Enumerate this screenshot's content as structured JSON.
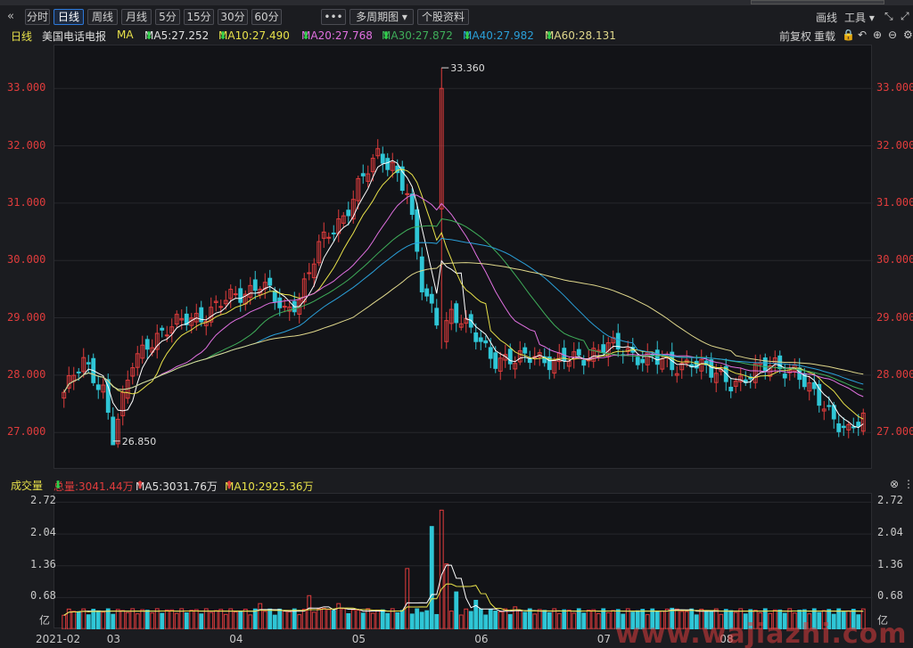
{
  "toolbar": {
    "collapse_icon": "double-chevron-left-icon",
    "periods": [
      "分时",
      "日线",
      "周线",
      "月线",
      "5分",
      "15分",
      "30分",
      "60分"
    ],
    "active_period": "日线",
    "more_label": "•••",
    "multi_period_label": "多周期图",
    "stock_info_label": "个股资料",
    "draw_label": "画线",
    "tools_label": "工具"
  },
  "legend": {
    "period": "日线",
    "stock_name": "美国电话电报",
    "ma_label": "MA",
    "ma5": "MA5:27.252",
    "ma10": "MA10:27.490",
    "ma20": "MA20:27.768",
    "ma30": "MA30:27.872",
    "ma40": "MA40:27.982",
    "ma60": "MA60:28.131",
    "restore_label": "前复权",
    "reload_label": "重载",
    "down_arrow": "⬇"
  },
  "price_axis": {
    "ticks": [
      "33.000",
      "32.000",
      "31.000",
      "30.000",
      "29.000",
      "28.000",
      "27.000"
    ],
    "tick_values": [
      33,
      32,
      31,
      30,
      29,
      28,
      27
    ],
    "min": 26.35,
    "max": 33.75,
    "high_marker": "33.360",
    "low_marker": "26.850"
  },
  "volume_legend": {
    "title": "成交量",
    "total": "总量:3041.44万",
    "ma5": "MA5:3031.76万",
    "ma10": "MA10:2925.36万",
    "up_arrow": "⬆",
    "down_arrow": "⬇"
  },
  "volume_axis": {
    "ticks": [
      "2.72",
      "2.04",
      "1.36",
      "0.68"
    ],
    "tick_values": [
      2.72,
      2.04,
      1.36,
      0.68
    ],
    "unit": "亿",
    "max": 2.9
  },
  "x_axis": {
    "labels": [
      "2021-02",
      "03",
      "04",
      "05",
      "06",
      "07",
      "08"
    ],
    "label_index": [
      0,
      10,
      35,
      60,
      85,
      110,
      135
    ]
  },
  "watermark": "www.wajiazhi.com",
  "colors": {
    "up": "#e03c3c",
    "down": "#2fc6d6",
    "ma5": "#ffffff",
    "ma10": "#e8e14a",
    "ma20": "#e070e0",
    "ma30": "#3fae5a",
    "ma40": "#2a9fd8",
    "ma60": "#e0d88c",
    "axis_red": "#e03c3c"
  },
  "chart_data": {
    "type": "candlestick",
    "anchors": {
      "idx": [
        0,
        4,
        8,
        10,
        12,
        14,
        17,
        22,
        25,
        30,
        35,
        40,
        45,
        48,
        52,
        57,
        60,
        64,
        67,
        70,
        73,
        77,
        79,
        82,
        85,
        88,
        92,
        96,
        100,
        105,
        110,
        115,
        120,
        124,
        128,
        132,
        136,
        140,
        145,
        149,
        152,
        156,
        160,
        163
      ],
      "close": [
        27.7,
        28.2,
        27.8,
        26.9,
        27.5,
        28.2,
        28.6,
        28.8,
        29.0,
        29.1,
        29.4,
        29.6,
        29.1,
        29.4,
        30.2,
        30.8,
        31.3,
        31.8,
        31.7,
        31.2,
        29.5,
        28.8,
        29.1,
        28.8,
        28.6,
        28.3,
        28.2,
        28.4,
        28.2,
        28.3,
        28.5,
        28.4,
        28.3,
        28.1,
        28.3,
        28.0,
        27.9,
        28.0,
        28.2,
        28.1,
        27.7,
        27.4,
        27.0,
        27.2
      ]
    },
    "highlow": {
      "high_index": 77,
      "high": 33.36,
      "low_index": 10,
      "low": 26.85
    },
    "volume": {
      "base": 0.3,
      "spikes": {
        "70": 1.3,
        "75": 2.2,
        "77": 2.55,
        "78": 1.4,
        "80": 0.8,
        "84": 0.62,
        "50": 0.72,
        "53": 0.45,
        "56": 0.55,
        "92": 0.48,
        "124": 0.45,
        "40": 0.55
      },
      "max": 2.9
    }
  }
}
